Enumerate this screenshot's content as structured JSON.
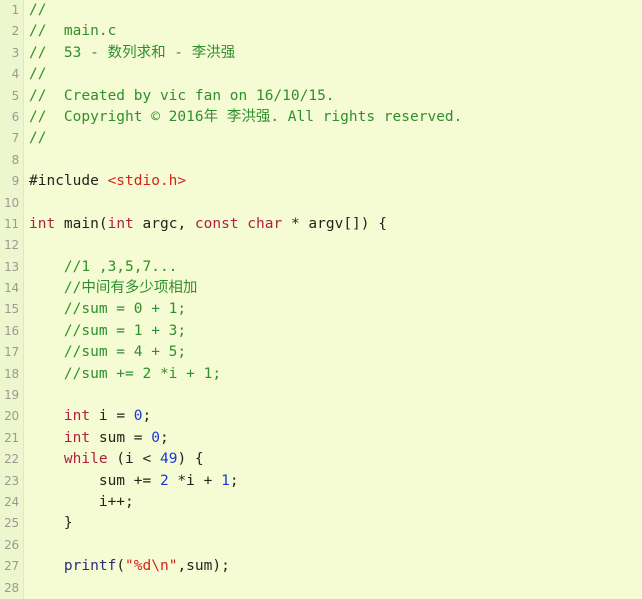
{
  "editor": {
    "background_color": "#f5fbd2",
    "gutter_color": "#eef6cd",
    "gutter_text_color": "#9a9a92",
    "first_visible_line": 1,
    "last_visible_line": 28,
    "total_visible_lines": 28
  },
  "syntax_colors": {
    "comment": "#2f8f2f",
    "keyword": "#b0213f",
    "number": "#1b38d8",
    "string": "#d4231a",
    "function": "#2b2b7a",
    "plain": "#24241f"
  },
  "line_numbers": [
    "1",
    "2",
    "3",
    "4",
    "5",
    "6",
    "7",
    "8",
    "9",
    "10",
    "11",
    "12",
    "13",
    "14",
    "15",
    "16",
    "17",
    "18",
    "19",
    "20",
    "21",
    "22",
    "23",
    "24",
    "25",
    "26",
    "27",
    "28"
  ],
  "code_lines": [
    {
      "number": "1",
      "tokens": [
        {
          "text": "//",
          "type": "comment"
        }
      ]
    },
    {
      "number": "2",
      "tokens": [
        {
          "text": "//  main.c",
          "type": "comment"
        }
      ]
    },
    {
      "number": "3",
      "tokens": [
        {
          "text": "//  53 - 数列求和 - 李洪强",
          "type": "comment"
        }
      ]
    },
    {
      "number": "4",
      "tokens": [
        {
          "text": "//",
          "type": "comment"
        }
      ]
    },
    {
      "number": "5",
      "tokens": [
        {
          "text": "//  Created by vic fan on 16/10/15.",
          "type": "comment"
        }
      ]
    },
    {
      "number": "6",
      "tokens": [
        {
          "text": "//  Copyright © 2016年 李洪强. All rights reserved.",
          "type": "comment"
        }
      ]
    },
    {
      "number": "7",
      "tokens": [
        {
          "text": "//",
          "type": "comment"
        }
      ]
    },
    {
      "number": "8",
      "tokens": []
    },
    {
      "number": "9",
      "tokens": [
        {
          "text": "#include ",
          "type": "preproc"
        },
        {
          "text": "<stdio.h>",
          "type": "string"
        }
      ]
    },
    {
      "number": "10",
      "tokens": []
    },
    {
      "number": "11",
      "tokens": [
        {
          "text": "int",
          "type": "keyword"
        },
        {
          "text": " main(",
          "type": "plain"
        },
        {
          "text": "int",
          "type": "keyword"
        },
        {
          "text": " argc, ",
          "type": "plain"
        },
        {
          "text": "const",
          "type": "keyword"
        },
        {
          "text": " ",
          "type": "plain"
        },
        {
          "text": "char",
          "type": "keyword"
        },
        {
          "text": " * argv[]) {",
          "type": "plain"
        }
      ]
    },
    {
      "number": "12",
      "tokens": []
    },
    {
      "number": "13",
      "tokens": [
        {
          "text": "    //1 ,3,5,7...",
          "type": "comment"
        }
      ]
    },
    {
      "number": "14",
      "tokens": [
        {
          "text": "    //中间有多少项相加",
          "type": "comment"
        }
      ]
    },
    {
      "number": "15",
      "tokens": [
        {
          "text": "    //sum = 0 + 1;",
          "type": "comment"
        }
      ]
    },
    {
      "number": "16",
      "tokens": [
        {
          "text": "    //sum = 1 + 3;",
          "type": "comment"
        }
      ]
    },
    {
      "number": "17",
      "tokens": [
        {
          "text": "    //sum = 4 + 5;",
          "type": "comment"
        }
      ]
    },
    {
      "number": "18",
      "tokens": [
        {
          "text": "    //sum += 2 *i + 1;",
          "type": "comment"
        }
      ]
    },
    {
      "number": "19",
      "tokens": []
    },
    {
      "number": "20",
      "tokens": [
        {
          "text": "    ",
          "type": "plain"
        },
        {
          "text": "int",
          "type": "keyword"
        },
        {
          "text": " i = ",
          "type": "plain"
        },
        {
          "text": "0",
          "type": "number"
        },
        {
          "text": ";",
          "type": "plain"
        }
      ]
    },
    {
      "number": "21",
      "tokens": [
        {
          "text": "    ",
          "type": "plain"
        },
        {
          "text": "int",
          "type": "keyword"
        },
        {
          "text": " sum = ",
          "type": "plain"
        },
        {
          "text": "0",
          "type": "number"
        },
        {
          "text": ";",
          "type": "plain"
        }
      ]
    },
    {
      "number": "22",
      "tokens": [
        {
          "text": "    ",
          "type": "plain"
        },
        {
          "text": "while",
          "type": "keyword"
        },
        {
          "text": " (i < ",
          "type": "plain"
        },
        {
          "text": "49",
          "type": "number"
        },
        {
          "text": ") {",
          "type": "plain"
        }
      ]
    },
    {
      "number": "23",
      "tokens": [
        {
          "text": "        sum += ",
          "type": "plain"
        },
        {
          "text": "2",
          "type": "number"
        },
        {
          "text": " *i + ",
          "type": "plain"
        },
        {
          "text": "1",
          "type": "number"
        },
        {
          "text": ";",
          "type": "plain"
        }
      ]
    },
    {
      "number": "24",
      "tokens": [
        {
          "text": "        i++;",
          "type": "plain"
        }
      ]
    },
    {
      "number": "25",
      "tokens": [
        {
          "text": "    }",
          "type": "plain"
        }
      ]
    },
    {
      "number": "26",
      "tokens": []
    },
    {
      "number": "27",
      "tokens": [
        {
          "text": "    ",
          "type": "plain"
        },
        {
          "text": "printf",
          "type": "function"
        },
        {
          "text": "(",
          "type": "plain"
        },
        {
          "text": "\"%d\\n\"",
          "type": "string"
        },
        {
          "text": ",sum);",
          "type": "plain"
        }
      ]
    },
    {
      "number": "28",
      "tokens": []
    }
  ]
}
